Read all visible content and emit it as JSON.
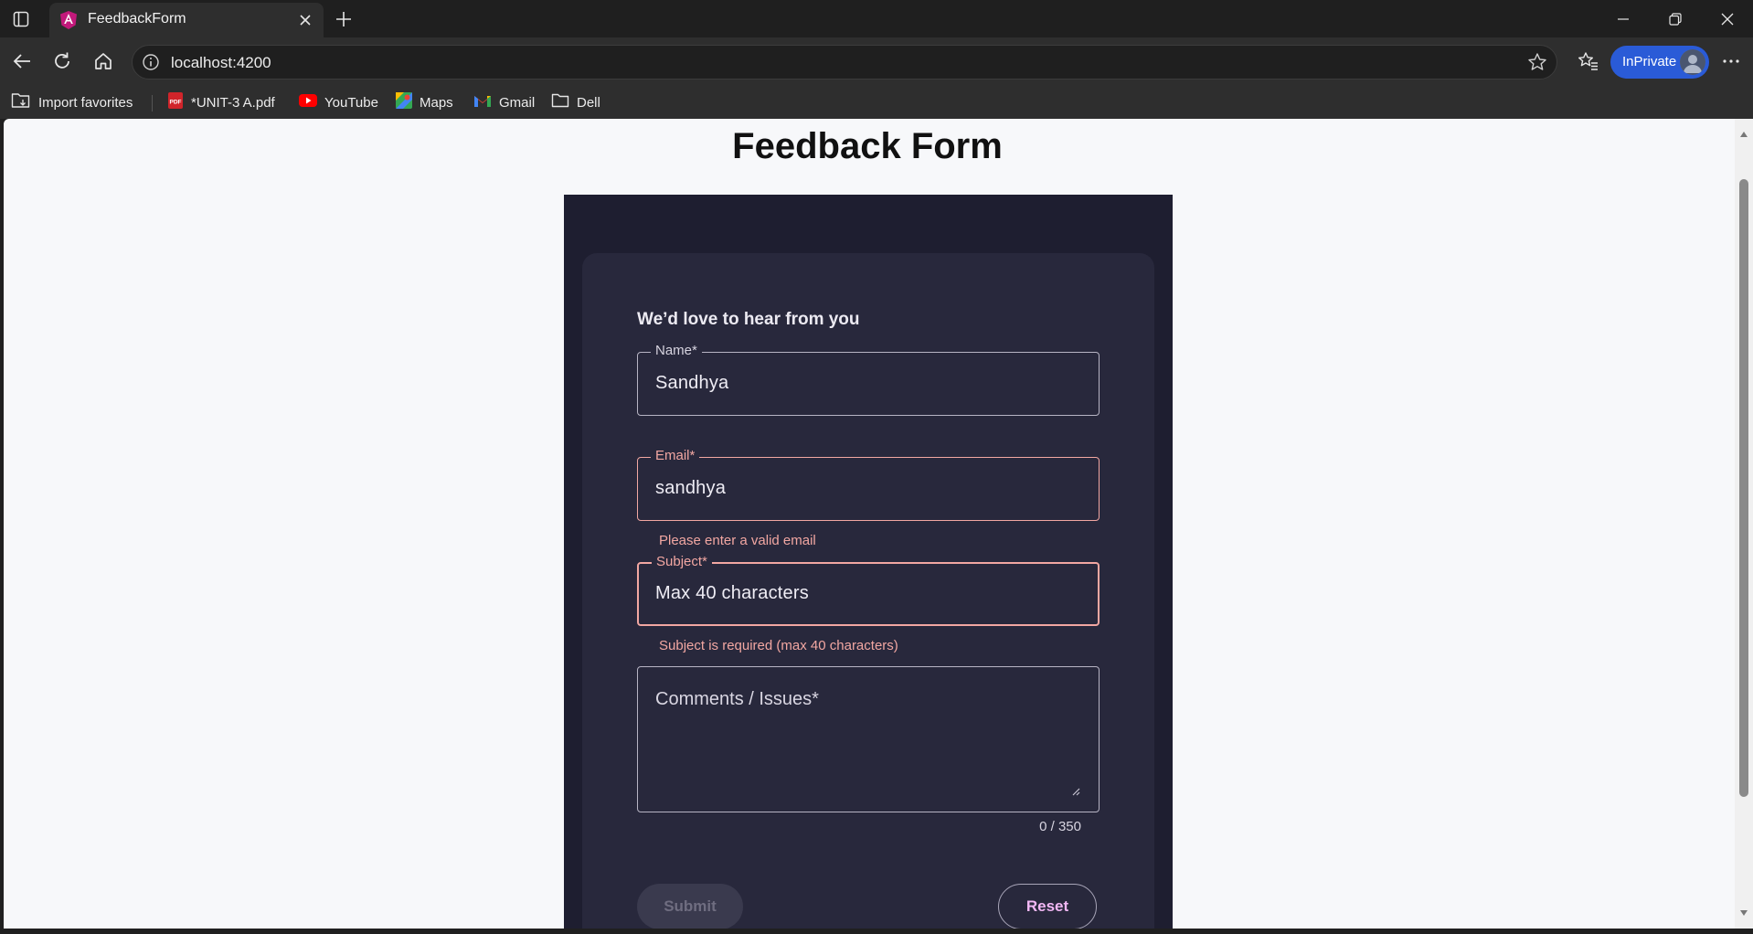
{
  "browser": {
    "tab_title": "FeedbackForm",
    "url": "localhost:4200",
    "inprivate_label": "InPrivate",
    "bookmarks": [
      {
        "label": "Import favorites",
        "icon": "import-icon"
      },
      {
        "label": "*UNIT-3 A.pdf",
        "icon": "pdf-icon"
      },
      {
        "label": "YouTube",
        "icon": "youtube-icon"
      },
      {
        "label": "Maps",
        "icon": "maps-icon"
      },
      {
        "label": "Gmail",
        "icon": "gmail-icon"
      },
      {
        "label": "Dell",
        "icon": "folder-icon"
      }
    ]
  },
  "page": {
    "title": "Feedback Form",
    "form": {
      "heading": "We’d love to hear from you",
      "name": {
        "label": "Name*",
        "value": "Sandhya"
      },
      "email": {
        "label": "Email*",
        "value": "sandhya",
        "error": "Please enter a valid email"
      },
      "subject": {
        "label": "Subject*",
        "placeholder": "Max 40 characters",
        "error": "Subject is required (max 40 characters)"
      },
      "comments": {
        "placeholder": "Comments / Issues*",
        "counter": "0 / 350"
      },
      "submit_label": "Submit",
      "reset_label": "Reset"
    }
  },
  "colors": {
    "panel_bg": "#1e1e30",
    "card_bg": "#28283c",
    "error": "#f2a7a2",
    "accent": "#f2b8f5",
    "inprivate": "#2a5bd7"
  }
}
